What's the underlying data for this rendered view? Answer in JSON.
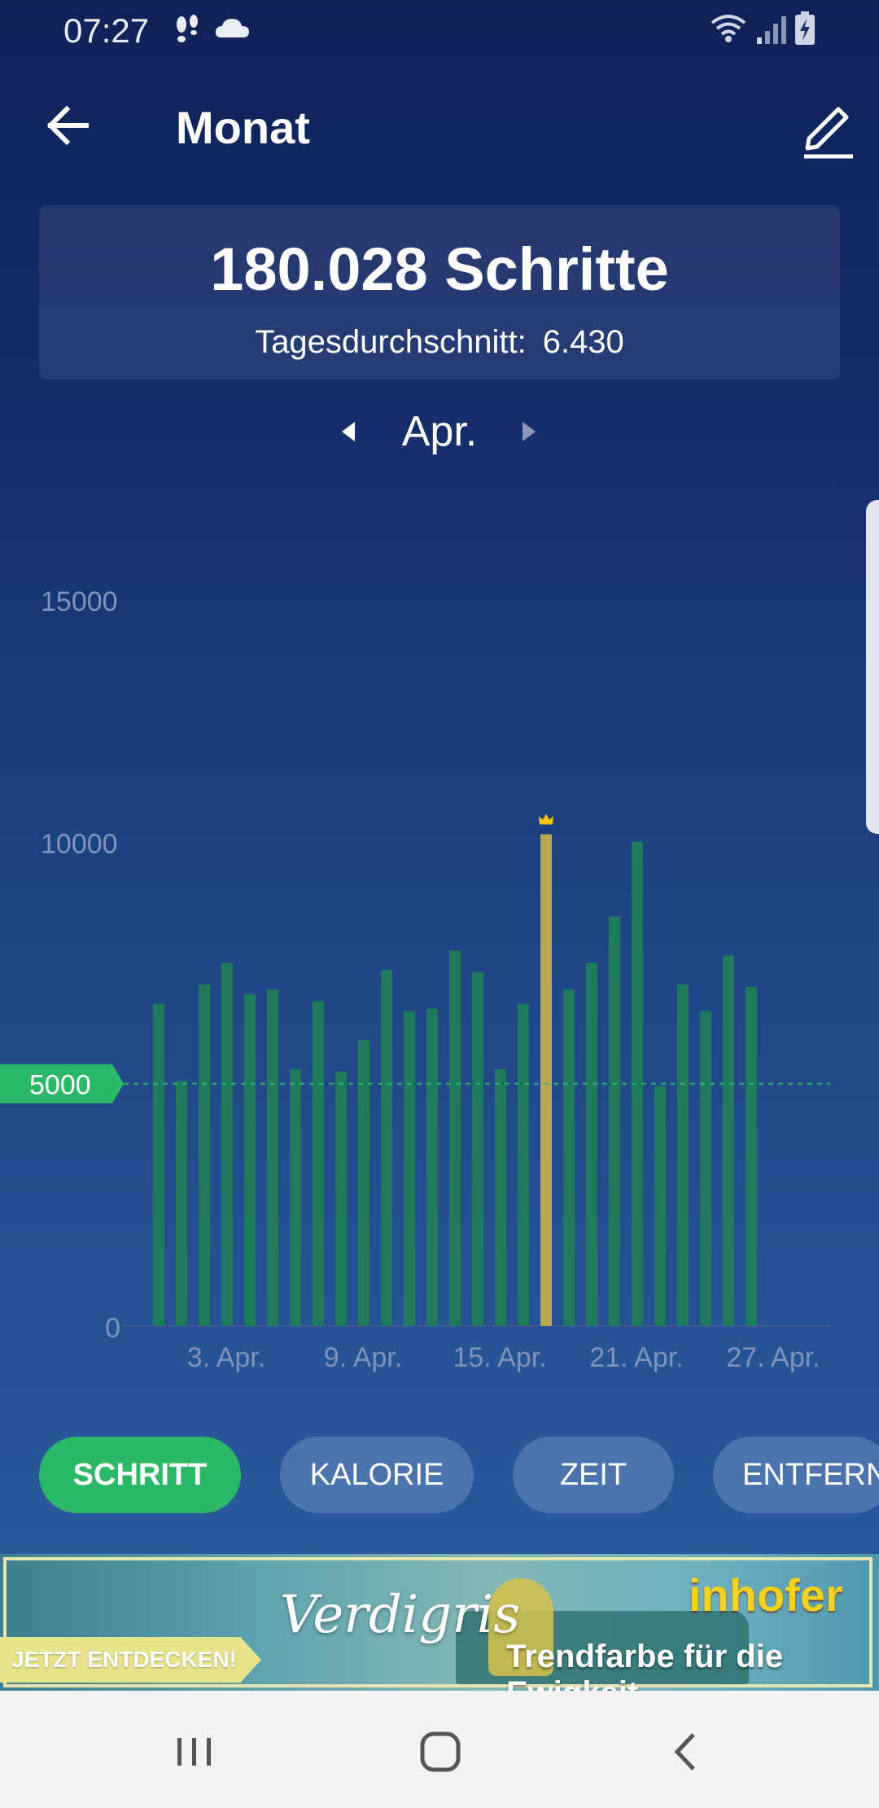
{
  "status_bar": {
    "time": "07:27",
    "icons": [
      "steps-icon",
      "cloud-icon",
      "wifi-icon",
      "signal-icon",
      "battery-charging-icon"
    ]
  },
  "header": {
    "title": "Monat",
    "back_icon": "arrow-left-icon",
    "edit_icon": "pencil-icon"
  },
  "summary": {
    "total": "180.028 Schritte",
    "average_label": "Tagesdurchschnitt:",
    "average_value": "6.430"
  },
  "month_nav": {
    "label": "Apr."
  },
  "chart_data": {
    "type": "bar",
    "categories": [
      "1",
      "2",
      "3",
      "4",
      "5",
      "6",
      "7",
      "8",
      "9",
      "10",
      "11",
      "12",
      "13",
      "14",
      "15",
      "16",
      "17",
      "18",
      "19",
      "20",
      "21",
      "22",
      "23",
      "24",
      "25",
      "26",
      "27",
      "28",
      "29",
      "30"
    ],
    "values": [
      0,
      6650,
      5050,
      7050,
      7500,
      6850,
      6950,
      5300,
      6700,
      5250,
      5900,
      7350,
      6500,
      6550,
      7750,
      7300,
      5300,
      6650,
      10150,
      6950,
      7500,
      8450,
      10000,
      4950,
      7050,
      6500,
      7650,
      7000,
      0,
      0
    ],
    "highlight_index": 18,
    "highlight_icon": "crown-icon",
    "ylim": [
      0,
      15000
    ],
    "yticks": [
      "0",
      "5000",
      "10000",
      "15000"
    ],
    "xticks": [
      "3. Apr.",
      "9. Apr.",
      "15. Apr.",
      "21. Apr.",
      "27. Apr."
    ],
    "xtick_days": [
      3,
      9,
      15,
      21,
      27
    ],
    "goal": 5000,
    "goal_label": "5000",
    "colors": {
      "bar": "#1f7a5c",
      "highlight": "#b9a850",
      "goal": "#2bb868",
      "axis_text": "#7f93bd"
    }
  },
  "tabs": [
    {
      "label": "SCHRITT",
      "active": true
    },
    {
      "label": "KALORIE",
      "active": false
    },
    {
      "label": "ZEIT",
      "active": false
    },
    {
      "label": "ENTFERN",
      "active": false
    }
  ],
  "ad": {
    "cta": "JETZT ENTDECKEN!",
    "script": "Verdigris",
    "brand": "inhofer",
    "tagline": "Trendfarbe für die Ewigkeit"
  },
  "nav_bar": {
    "icons": [
      "recent-apps-icon",
      "home-icon",
      "back-icon"
    ]
  }
}
